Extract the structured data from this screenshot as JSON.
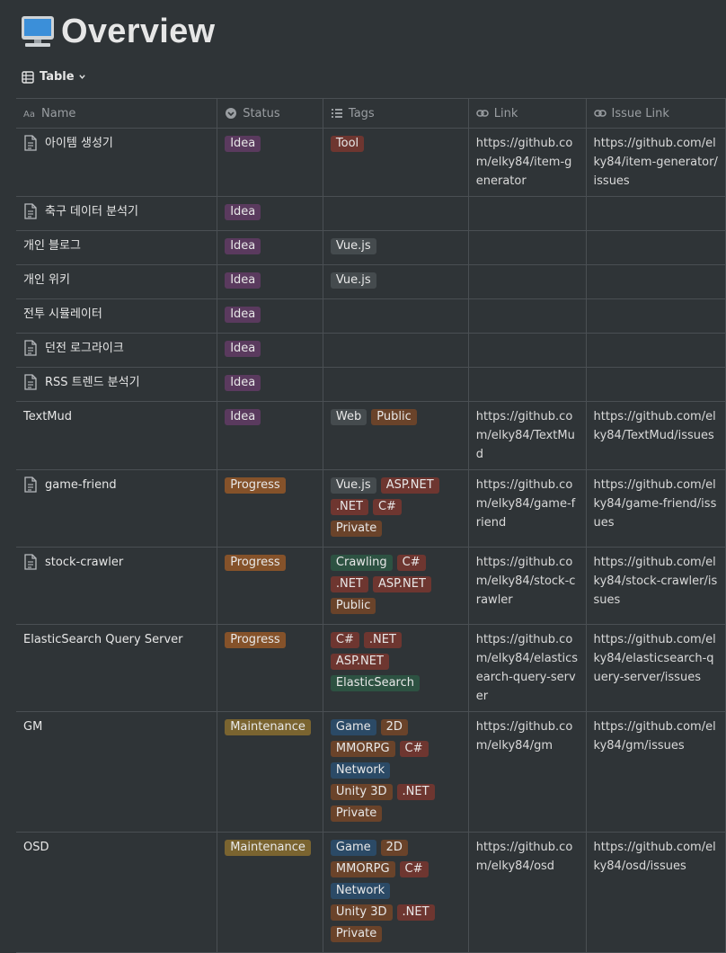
{
  "page": {
    "title": "Overview",
    "icon": "computer-icon"
  },
  "view": {
    "label": "Table",
    "icon": "table-icon"
  },
  "columns": {
    "name": "Name",
    "status": "Status",
    "tags": "Tags",
    "link": "Link",
    "issue_link": "Issue Link"
  },
  "colors": {
    "purple": "#5a3a5e",
    "red": "#6e3630",
    "gray": "#454b4e",
    "brown": "#6a432a",
    "orange": "#85522a",
    "green": "#2d5242",
    "blue": "#2b4a66",
    "yellow": "#7a6430"
  },
  "rows": [
    {
      "name": "아이템 생성기",
      "page_icon": true,
      "status": {
        "label": "Idea",
        "color": "purple"
      },
      "tags": [
        {
          "label": "Tool",
          "color": "red"
        }
      ],
      "link": "https://github.com/elky84/item-generator",
      "issue_link": "https://github.com/elky84/item-generator/issues"
    },
    {
      "name": "축구 데이터 분석기",
      "page_icon": true,
      "status": {
        "label": "Idea",
        "color": "purple"
      },
      "tags": [],
      "link": "",
      "issue_link": ""
    },
    {
      "name": "개인 블로그",
      "page_icon": false,
      "status": {
        "label": "Idea",
        "color": "purple"
      },
      "tags": [
        {
          "label": "Vue.js",
          "color": "gray"
        }
      ],
      "link": "",
      "issue_link": ""
    },
    {
      "name": "개인 위키",
      "page_icon": false,
      "status": {
        "label": "Idea",
        "color": "purple"
      },
      "tags": [
        {
          "label": "Vue.js",
          "color": "gray"
        }
      ],
      "link": "",
      "issue_link": ""
    },
    {
      "name": "전투 시뮬레이터",
      "page_icon": false,
      "status": {
        "label": "Idea",
        "color": "purple"
      },
      "tags": [],
      "link": "",
      "issue_link": ""
    },
    {
      "name": "던전 로그라이크",
      "page_icon": true,
      "status": {
        "label": "Idea",
        "color": "purple"
      },
      "tags": [],
      "link": "",
      "issue_link": ""
    },
    {
      "name": "RSS 트렌드 분석기",
      "page_icon": true,
      "status": {
        "label": "Idea",
        "color": "purple"
      },
      "tags": [],
      "link": "",
      "issue_link": ""
    },
    {
      "name": "TextMud",
      "page_icon": false,
      "status": {
        "label": "Idea",
        "color": "purple"
      },
      "tags": [
        {
          "label": "Web",
          "color": "gray"
        },
        {
          "label": "Public",
          "color": "brown"
        }
      ],
      "link": "https://github.com/elky84/TextMud",
      "issue_link": "https://github.com/elky84/TextMud/issues"
    },
    {
      "name": "game-friend",
      "page_icon": true,
      "status": {
        "label": "Progress",
        "color": "orange"
      },
      "tags": [
        {
          "label": "Vue.js",
          "color": "gray"
        },
        {
          "label": "ASP.NET",
          "color": "red"
        },
        {
          "label": ".NET",
          "color": "red"
        },
        {
          "label": "C#",
          "color": "red"
        },
        {
          "label": "Private",
          "color": "brown"
        }
      ],
      "link": "https://github.com/elky84/game-friend",
      "issue_link": "https://github.com/elky84/game-friend/issues"
    },
    {
      "name": "stock-crawler",
      "page_icon": true,
      "status": {
        "label": "Progress",
        "color": "orange"
      },
      "tags": [
        {
          "label": "Crawling",
          "color": "green"
        },
        {
          "label": "C#",
          "color": "red"
        },
        {
          "label": ".NET",
          "color": "red"
        },
        {
          "label": "ASP.NET",
          "color": "red"
        },
        {
          "label": "Public",
          "color": "brown"
        }
      ],
      "link": "https://github.com/elky84/stock-crawler",
      "issue_link": "https://github.com/elky84/stock-crawler/issues"
    },
    {
      "name": "ElasticSearch Query Server",
      "page_icon": false,
      "status": {
        "label": "Progress",
        "color": "orange"
      },
      "tags": [
        {
          "label": "C#",
          "color": "red"
        },
        {
          "label": ".NET",
          "color": "red"
        },
        {
          "label": "ASP.NET",
          "color": "red"
        },
        {
          "label": "ElasticSearch",
          "color": "green"
        }
      ],
      "link": "https://github.com/elky84/elasticsearch-query-server",
      "issue_link": "https://github.com/elky84/elasticsearch-query-server/issues"
    },
    {
      "name": "GM",
      "page_icon": false,
      "status": {
        "label": "Maintenance",
        "color": "yellow"
      },
      "tags": [
        {
          "label": "Game",
          "color": "blue"
        },
        {
          "label": "2D",
          "color": "brown"
        },
        {
          "label": "MMORPG",
          "color": "brown"
        },
        {
          "label": "C#",
          "color": "red"
        },
        {
          "label": "Network",
          "color": "blue"
        },
        {
          "label": "Unity 3D",
          "color": "brown"
        },
        {
          "label": ".NET",
          "color": "red"
        },
        {
          "label": "Private",
          "color": "brown"
        }
      ],
      "link": "https://github.com/elky84/gm",
      "issue_link": "https://github.com/elky84/gm/issues"
    },
    {
      "name": "OSD",
      "page_icon": false,
      "status": {
        "label": "Maintenance",
        "color": "yellow"
      },
      "tags": [
        {
          "label": "Game",
          "color": "blue"
        },
        {
          "label": "2D",
          "color": "brown"
        },
        {
          "label": "MMORPG",
          "color": "brown"
        },
        {
          "label": "C#",
          "color": "red"
        },
        {
          "label": "Network",
          "color": "blue"
        },
        {
          "label": "Unity 3D",
          "color": "brown"
        },
        {
          "label": ".NET",
          "color": "red"
        },
        {
          "label": "Private",
          "color": "brown"
        }
      ],
      "link": "https://github.com/elky84/osd",
      "issue_link": "https://github.com/elky84/osd/issues"
    }
  ]
}
